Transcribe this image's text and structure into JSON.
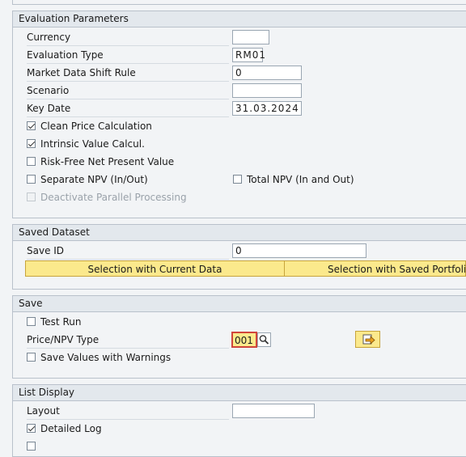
{
  "eval": {
    "title": "Evaluation Parameters",
    "currency_label": "Currency",
    "currency_value": "",
    "eval_type_label": "Evaluation Type",
    "eval_type_value": "RM01",
    "mds_label": "Market Data Shift Rule",
    "mds_value": "0",
    "scenario_label": "Scenario",
    "scenario_value": "",
    "key_date_label": "Key Date",
    "key_date_value": "31.03.2024",
    "clean_price_label": "Clean Price Calculation",
    "clean_price_checked": true,
    "intrinsic_label": "Intrinsic Value Calcul.",
    "intrinsic_checked": true,
    "riskfree_label": "Risk-Free Net Present Value",
    "riskfree_checked": false,
    "sep_npv_label": "Separate NPV (In/Out)",
    "sep_npv_checked": false,
    "total_npv_label": "Total NPV (In and Out)",
    "total_npv_checked": false,
    "parallel_label": "Deactivate Parallel Processing",
    "parallel_checked": false
  },
  "saved": {
    "title": "Saved Dataset",
    "save_id_label": "Save ID",
    "save_id_value": "0",
    "btn_current": "Selection with Current Data",
    "btn_saved": "Selection with Saved Portfolio H"
  },
  "save": {
    "title": "Save",
    "test_run_label": "Test Run",
    "test_run_checked": false,
    "price_npv_label": "Price/NPV Type",
    "price_npv_value": "001",
    "warn_label": "Save Values with Warnings",
    "warn_checked": false
  },
  "list": {
    "title": "List Display",
    "layout_label": "Layout",
    "layout_value": "",
    "detailed_log_label": "Detailed Log",
    "detailed_log_checked": true
  },
  "colors": {
    "accent_button": "#fbe98c",
    "required_border": "#d0453b"
  },
  "icons": {
    "search": "search-icon",
    "export": "export-arrow-icon"
  }
}
